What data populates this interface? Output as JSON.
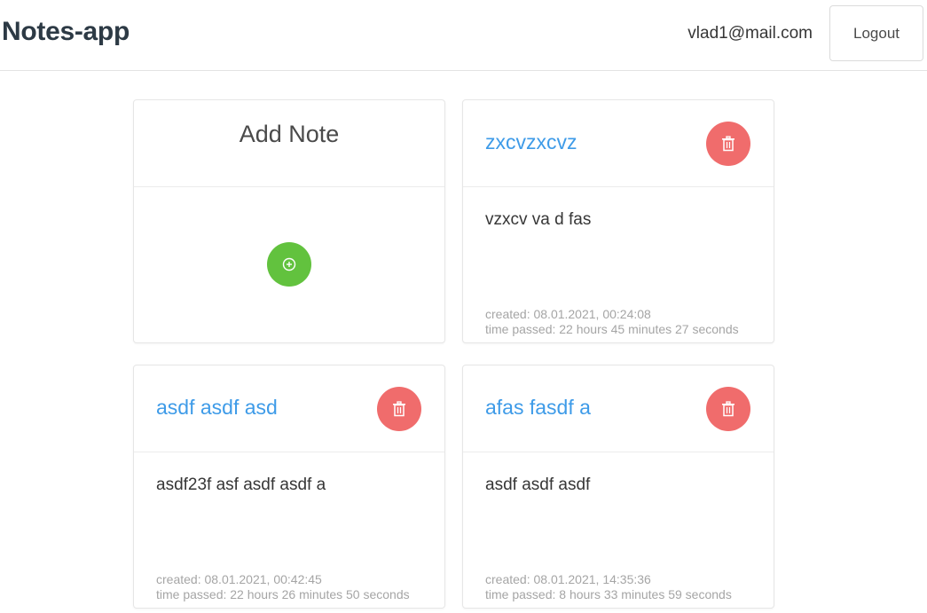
{
  "app": {
    "brand": "Notes-app",
    "user_email": "vlad1@mail.com",
    "logout_label": "Logout"
  },
  "add_card": {
    "title": "Add Note",
    "button_icon": "plus-circle-icon",
    "button_color": "#62c23e"
  },
  "colors": {
    "title": "#3e9be8",
    "delete": "#f06c6c",
    "meta": "#a5a5a5"
  },
  "notes": [
    {
      "title": "zxcvzxcvz",
      "body": "vzxcv va d fas",
      "created": "created: 08.01.2021, 00:24:08",
      "time_passed": "time passed: 22 hours 45 minutes 27 seconds",
      "delete_icon": "trash-icon"
    },
    {
      "title": "asdf asdf asd",
      "body": "asdf23f asf asdf asdf a",
      "created": "created: 08.01.2021, 00:42:45",
      "time_passed": "time passed: 22 hours 26 minutes 50 seconds",
      "delete_icon": "trash-icon"
    },
    {
      "title": "afas fasdf a",
      "body": "asdf asdf asdf",
      "created": "created: 08.01.2021, 14:35:36",
      "time_passed": "time passed: 8 hours 33 minutes 59 seconds",
      "delete_icon": "trash-icon"
    }
  ]
}
